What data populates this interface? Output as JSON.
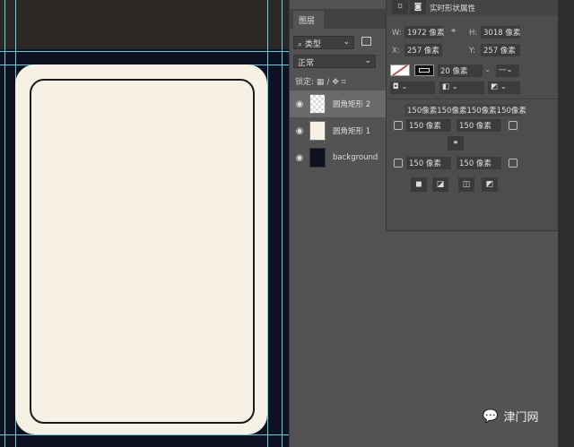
{
  "layers_panel": {
    "tab": "图层",
    "filter": "类型",
    "blend_mode": "正常",
    "lock_label": "锁定:",
    "layers": [
      {
        "name": "圆角矩形 2",
        "selected": true
      },
      {
        "name": "圆角矩形 1",
        "selected": false
      },
      {
        "name": "background",
        "selected": false
      }
    ]
  },
  "properties": {
    "title": "实时形状属性",
    "w_label": "W:",
    "w": "1972 像素",
    "h_label": "H:",
    "h": "3018 像素",
    "x_label": "X:",
    "x": "257 像素",
    "y_label": "Y:",
    "y": "257 像素",
    "stroke_width": "20 像素",
    "corner_summary": "150像素150像素150像素150像素",
    "corners": [
      "150 像素",
      "150 像素",
      "150 像素",
      "150 像素"
    ]
  },
  "watermark": "津门网",
  "colors": {
    "card": "#f7f0e5",
    "canvas": "#0f1220",
    "guide": "#5fd0e0"
  }
}
